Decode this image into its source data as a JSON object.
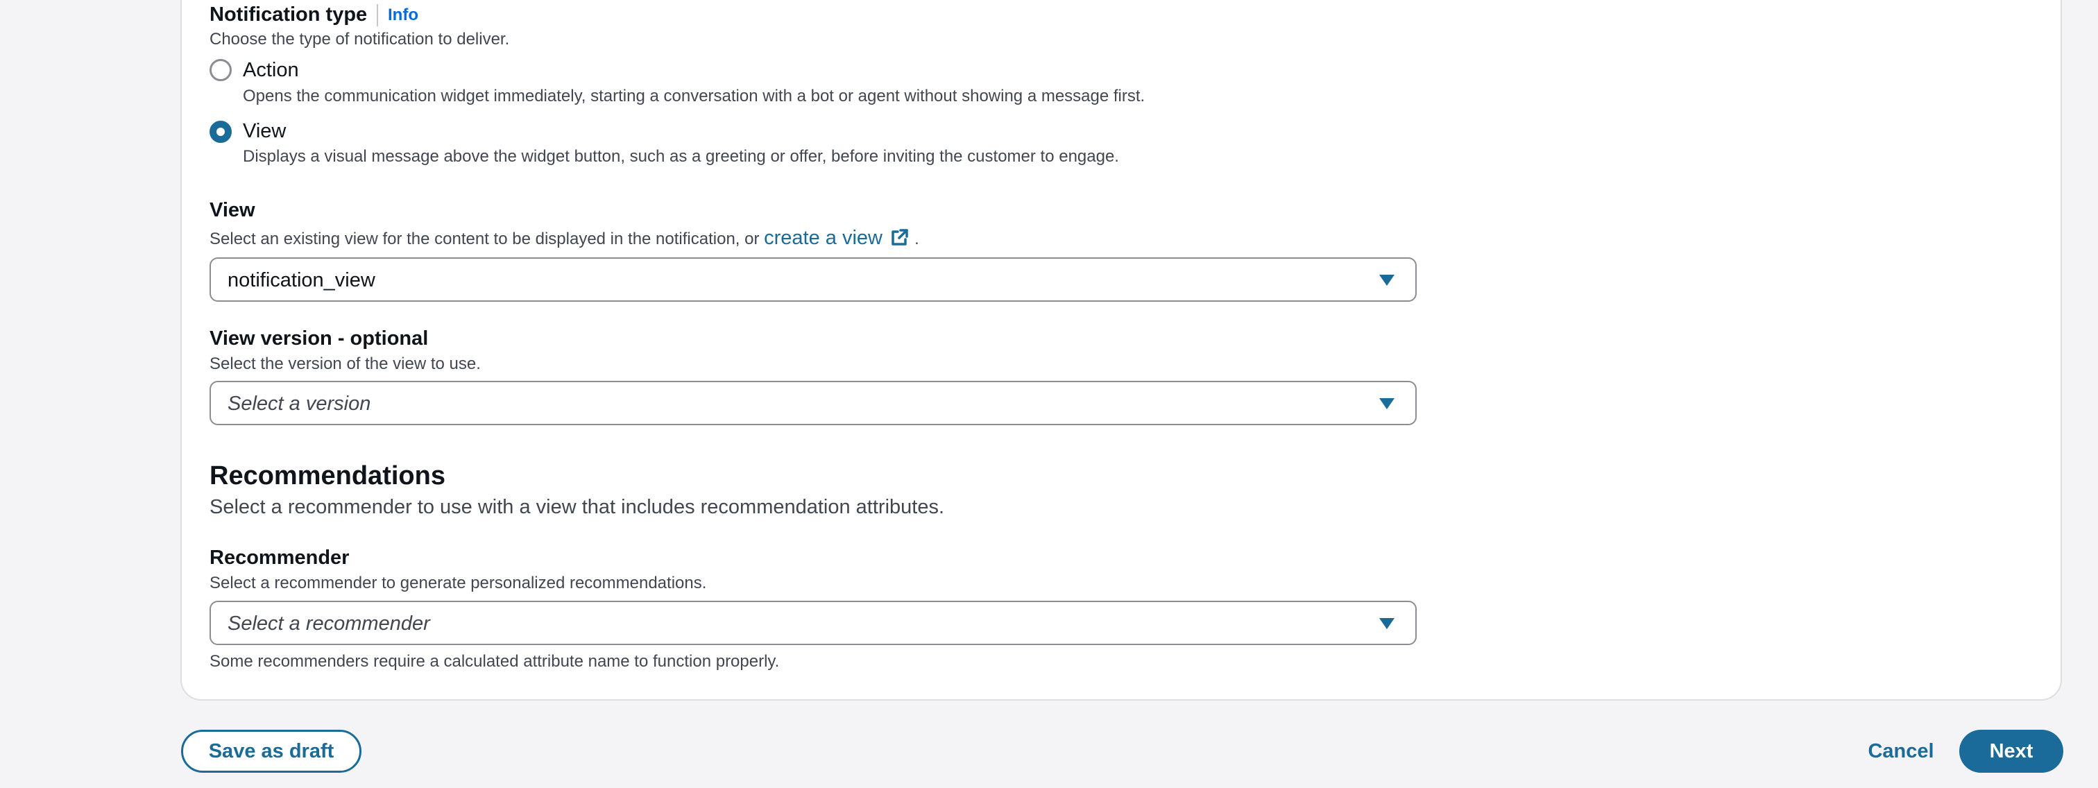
{
  "notification_type": {
    "label": "Notification type",
    "info": "Info",
    "description": "Choose the type of notification to deliver.",
    "options": [
      {
        "label": "Action",
        "description": "Opens the communication widget immediately, starting a conversation with a bot or agent without showing a message first.",
        "selected": false
      },
      {
        "label": "View",
        "description": "Displays a visual message above the widget button, such as a greeting or offer, before inviting the customer to engage.",
        "selected": true
      }
    ]
  },
  "view": {
    "label": "View",
    "description_prefix": "Select an existing view for the content to be displayed in the notification, or",
    "link": "create a view",
    "description_suffix": ".",
    "value": "notification_view"
  },
  "view_version": {
    "label": "View version - optional",
    "description": "Select the version of the view to use.",
    "placeholder": "Select a version"
  },
  "recommendations": {
    "title": "Recommendations",
    "description": "Select a recommender to use with a view that includes recommendation attributes.",
    "recommender": {
      "label": "Recommender",
      "description": "Select a recommender to generate personalized recommendations.",
      "placeholder": "Select a recommender",
      "constraint": "Some recommenders require a calculated attribute name to function properly."
    }
  },
  "footer": {
    "save_draft": "Save as draft",
    "cancel": "Cancel",
    "next": "Next"
  },
  "icons": {
    "external_link": "external-link-icon",
    "dropdown": "caret-down-icon"
  },
  "colors": {
    "accent": "#1b6b9a",
    "info_link": "#006ce0"
  }
}
